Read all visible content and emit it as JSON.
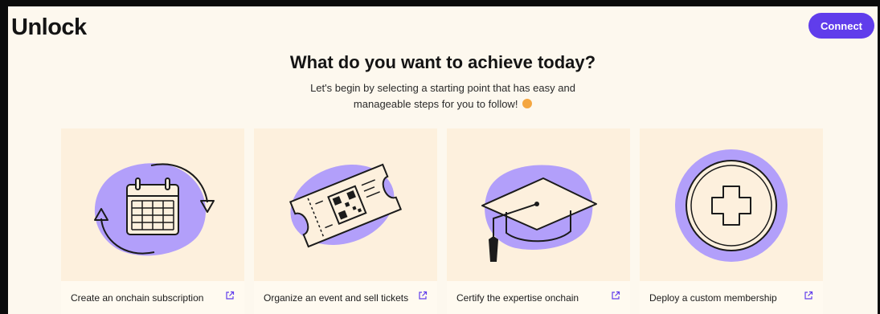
{
  "header": {
    "logo_text": "Unlock",
    "connect_label": "Connect"
  },
  "main": {
    "title": "What do you want to achieve today?",
    "subtitle_line1": "Let's begin by selecting a starting point that has easy and",
    "subtitle_line2": "manageable steps for you to follow!",
    "emoji": "smiling-face-icon"
  },
  "cards": [
    {
      "label": "Create an onchain subscription",
      "icon": "calendar-cycle-icon"
    },
    {
      "label": "Organize an event and sell tickets",
      "icon": "ticket-qr-icon"
    },
    {
      "label": "Certify the expertise onchain",
      "icon": "graduation-cap-icon"
    },
    {
      "label": "Deploy a custom membership",
      "icon": "plus-circle-icon"
    }
  ],
  "colors": {
    "accent": "#603deb",
    "blob": "#b29ffa",
    "card_bg": "#fdf0dd",
    "page_bg": "#fdf8ee"
  }
}
